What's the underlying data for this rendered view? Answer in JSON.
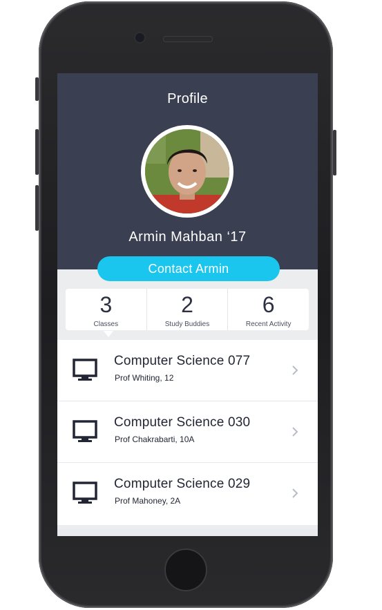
{
  "screen": {
    "title": "Profile",
    "profile": {
      "name": "Armin Mahban ‘17",
      "contact_label": "Contact Armin"
    },
    "stats": [
      {
        "value": "3",
        "label": "Classes"
      },
      {
        "value": "2",
        "label": "Study Buddies"
      },
      {
        "value": "6",
        "label": "Recent Activity"
      }
    ],
    "classes": [
      {
        "title": "Computer Science 077",
        "subtitle": "Prof Whiting, 12",
        "icon": "monitor-icon"
      },
      {
        "title": "Computer Science 030",
        "subtitle": "Prof Chakrabarti, 10A",
        "icon": "monitor-icon"
      },
      {
        "title": "Computer Science 029",
        "subtitle": "Prof Mahoney, 2A",
        "icon": "monitor-icon"
      }
    ],
    "colors": {
      "header_bg": "#3a3f51",
      "accent": "#1ac6ee",
      "text_dark": "#222634"
    }
  }
}
